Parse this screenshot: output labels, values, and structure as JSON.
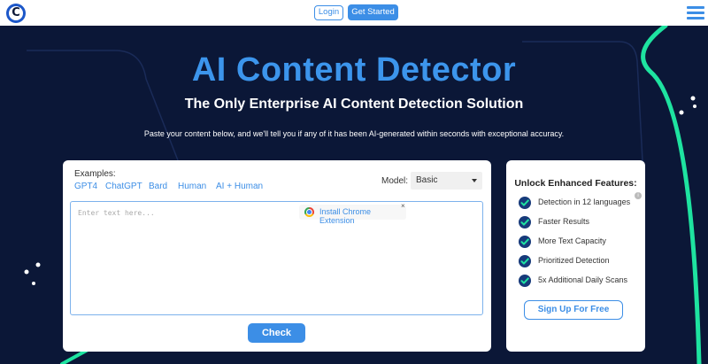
{
  "header": {
    "logo_letter": "C",
    "login_label": "Login",
    "get_started_label": "Get Started"
  },
  "hero": {
    "title": "AI Content Detector",
    "subtitle": "The Only Enterprise AI Content Detection Solution",
    "description": "Paste your content below, and we'll tell you if any of it has been AI-generated within seconds with exceptional accuracy."
  },
  "detector": {
    "examples_label": "Examples:",
    "examples": [
      "GPT4",
      "ChatGPT",
      "Bard",
      "Human",
      "AI + Human"
    ],
    "model_label": "Model:",
    "model_selected": "Basic",
    "text_placeholder": "Enter text here...",
    "chrome_extension_label": "Install Chrome Extension",
    "chrome_close": "×",
    "check_label": "Check"
  },
  "features": {
    "title": "Unlock Enhanced Features:",
    "items": [
      "Detection in 12 languages",
      "Faster Results",
      "More Text Capacity",
      "Prioritized Detection",
      "5x Additional Daily Scans"
    ],
    "info_icon_glyph": "i",
    "signup_label": "Sign Up For Free"
  },
  "colors": {
    "background": "#0b1737",
    "accent": "#3c8ee6",
    "title_blue": "#3c95ec",
    "decoration_green": "#1ee3a0",
    "check_badge": "#163a7a"
  },
  "icons": {
    "logo": "c-logo-icon",
    "menu": "hamburger-menu-icon",
    "chrome": "chrome-icon",
    "check": "check-badge-icon",
    "info": "info-icon",
    "caret": "chevron-down-icon"
  }
}
